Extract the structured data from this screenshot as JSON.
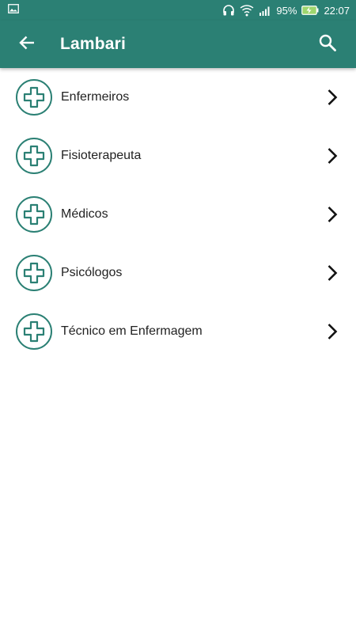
{
  "colors": {
    "primary": "#2b8074",
    "text": "#222222",
    "icon_outline": "#2b8074"
  },
  "status_bar": {
    "battery_percent": "95%",
    "time": "22:07"
  },
  "app_bar": {
    "title": "Lambari",
    "back_icon": "arrow-left-icon",
    "search_icon": "search-icon"
  },
  "list": {
    "items": [
      {
        "label": "Enfermeiros",
        "icon": "medical-cross-icon"
      },
      {
        "label": "Fisioterapeuta",
        "icon": "medical-cross-icon"
      },
      {
        "label": "Médicos",
        "icon": "medical-cross-icon"
      },
      {
        "label": "Psicólogos",
        "icon": "medical-cross-icon"
      },
      {
        "label": "Técnico em Enfermagem",
        "icon": "medical-cross-icon"
      }
    ]
  }
}
